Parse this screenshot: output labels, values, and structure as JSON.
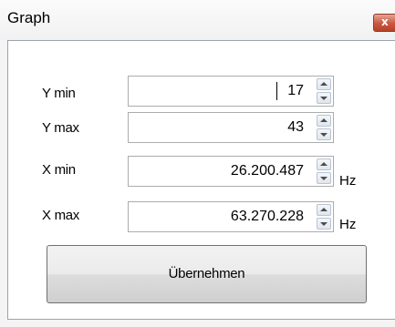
{
  "window": {
    "title": "Graph",
    "close_glyph": "x"
  },
  "fields": {
    "ymin": {
      "label": "Y min",
      "value": "17",
      "unit": ""
    },
    "ymax": {
      "label": "Y max",
      "value": "43",
      "unit": ""
    },
    "xmin": {
      "label": "X min",
      "value": "26.200.487",
      "unit": "Hz"
    },
    "xmax": {
      "label": "X max",
      "value": "63.270.228",
      "unit": "Hz"
    }
  },
  "apply_button": {
    "label": "Übernehmen"
  },
  "icons": {
    "close": "close-icon",
    "spin_up": "chevron-up-icon",
    "spin_down": "chevron-down-icon"
  },
  "colors": {
    "close_button": "#c9573e",
    "field_border": "#acacac",
    "button_border": "#707070"
  }
}
